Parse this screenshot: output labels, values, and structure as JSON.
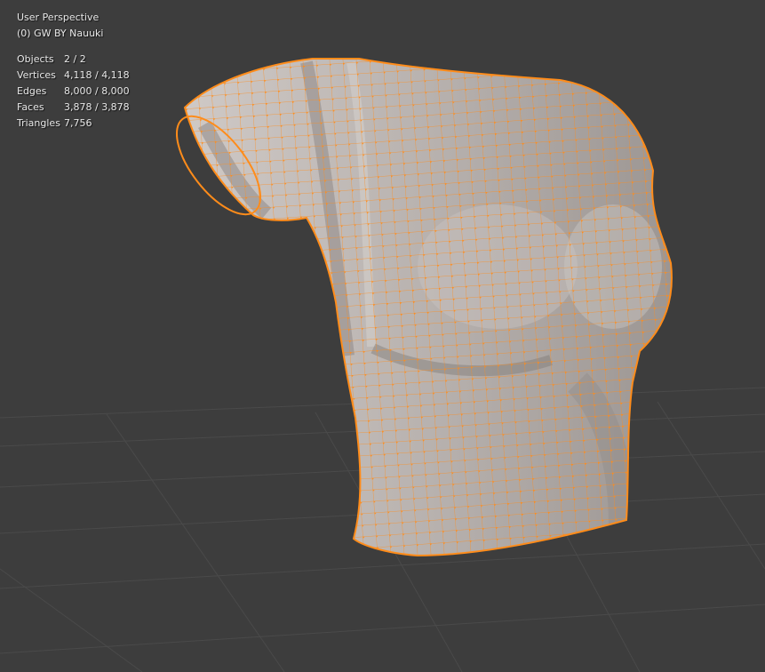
{
  "viewport": {
    "view_name": "User Perspective",
    "object_name": "(0) GW BY Nauuki"
  },
  "stats": {
    "objects_label": "Objects",
    "objects_value": "2 / 2",
    "vertices_label": "Vertices",
    "vertices_value": "4,118 / 4,118",
    "edges_label": "Edges",
    "edges_value": "8,000 / 8,000",
    "faces_label": "Faces",
    "faces_value": "3,878 / 3,878",
    "triangles_label": "Triangles",
    "triangles_value": "7,756"
  },
  "colors": {
    "background": "#3d3d3d",
    "grid": "#4a4a4a",
    "mesh_surface": "#a8a4a2",
    "selection": "#ff8c1a"
  }
}
